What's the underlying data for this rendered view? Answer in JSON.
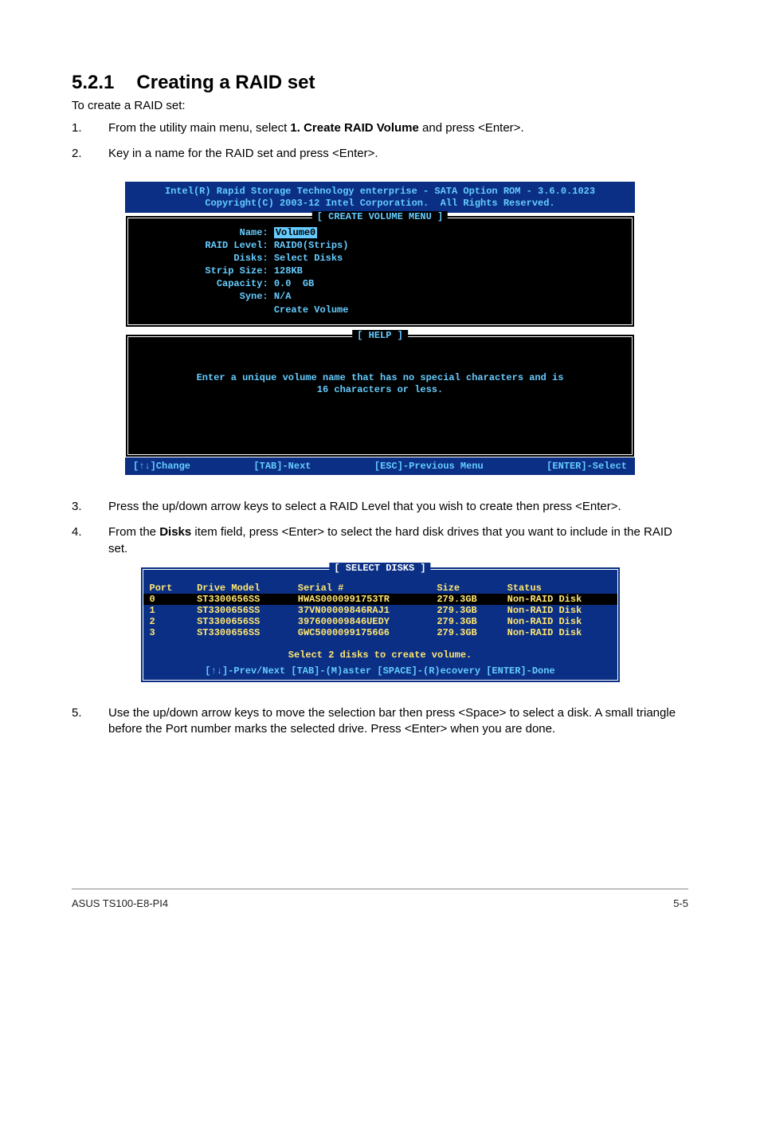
{
  "section": {
    "number": "5.2.1",
    "title": "Creating a RAID set"
  },
  "intro": "To create a RAID set:",
  "steps": [
    {
      "num": "1.",
      "text_before": "From the utility main menu, select ",
      "bold": "1. Create RAID Volume",
      "text_after": " and press <Enter>."
    },
    {
      "num": "2.",
      "text_before": "Key in a name for the RAID set and press <Enter>.",
      "bold": "",
      "text_after": ""
    },
    {
      "num": "3.",
      "text_before": "Press the up/down arrow keys to select a RAID Level that you wish to create then press <Enter>.",
      "bold": "",
      "text_after": ""
    },
    {
      "num": "4.",
      "text_before": "From the ",
      "bold": "Disks",
      "text_after": " item field, press <Enter> to select the hard disk drives that you want to include in the RAID set."
    },
    {
      "num": "5.",
      "text_before": "Use the up/down arrow keys to move the selection bar then press <Space> to select a disk. A small triangle before the Port number marks the selected drive. Press <Enter> when you are done.",
      "bold": "",
      "text_after": ""
    }
  ],
  "screenshot1": {
    "banner_line1": "Intel(R) Rapid Storage Technology enterprise - SATA Option ROM - 3.6.0.1023",
    "banner_line2": "Copyright(C) 2003-12 Intel Corporation.  All Rights Reserved.",
    "create_title": "[ CREATE VOLUME MENU ]",
    "fields": {
      "name_label": "Name:",
      "name_value": "Volume0",
      "raid_level_label": "RAID Level:",
      "raid_level_value": "RAID0(Strips)",
      "disks_label": "Disks:",
      "disks_value": "Select Disks",
      "strip_label": "Strip Size:",
      "strip_value": "128KB",
      "capacity_label": "Capacity:",
      "capacity_value": "0.0  GB",
      "syne_label": "Syne:",
      "syne_value": "N/A",
      "create_volume": "Create Volume"
    },
    "help_title": "[ HELP ]",
    "help_line1": "Enter a unique volume name that has no special characters and is",
    "help_line2": "16 characters or less.",
    "footer": {
      "change": "[↑↓]Change",
      "tab": "[TAB]-Next",
      "esc": "[ESC]-Previous Menu",
      "enter": "[ENTER]-Select"
    }
  },
  "screenshot2": {
    "title": "[ SELECT DISKS ]",
    "headers": {
      "port": "Port",
      "model": "Drive Model",
      "serial": "Serial #",
      "size": "Size",
      "status": "Status"
    },
    "rows": [
      {
        "port": "0",
        "model": "ST3300656SS",
        "serial": "HWAS0000991753TR",
        "size": "279.3GB",
        "status": "Non-RAID Disk",
        "selected": true
      },
      {
        "port": "1",
        "model": "ST3300656SS",
        "serial": "37VN00009846RAJ1",
        "size": "279.3GB",
        "status": "Non-RAID Disk",
        "selected": false
      },
      {
        "port": "2",
        "model": "ST3300656SS",
        "serial": "397600009846UEDY",
        "size": "279.3GB",
        "status": "Non-RAID Disk",
        "selected": false
      },
      {
        "port": "3",
        "model": "ST3300656SS",
        "serial": "GWC50000991756G6",
        "size": "279.3GB",
        "status": "Non-RAID Disk",
        "selected": false
      }
    ],
    "msg": "Select 2 disks to create volume.",
    "help": "[↑↓]-Prev/Next [TAB]-(M)aster [SPACE]-(R)ecovery [ENTER]-Done"
  },
  "footer": {
    "left": "ASUS TS100-E8-PI4",
    "right": "5-5"
  }
}
